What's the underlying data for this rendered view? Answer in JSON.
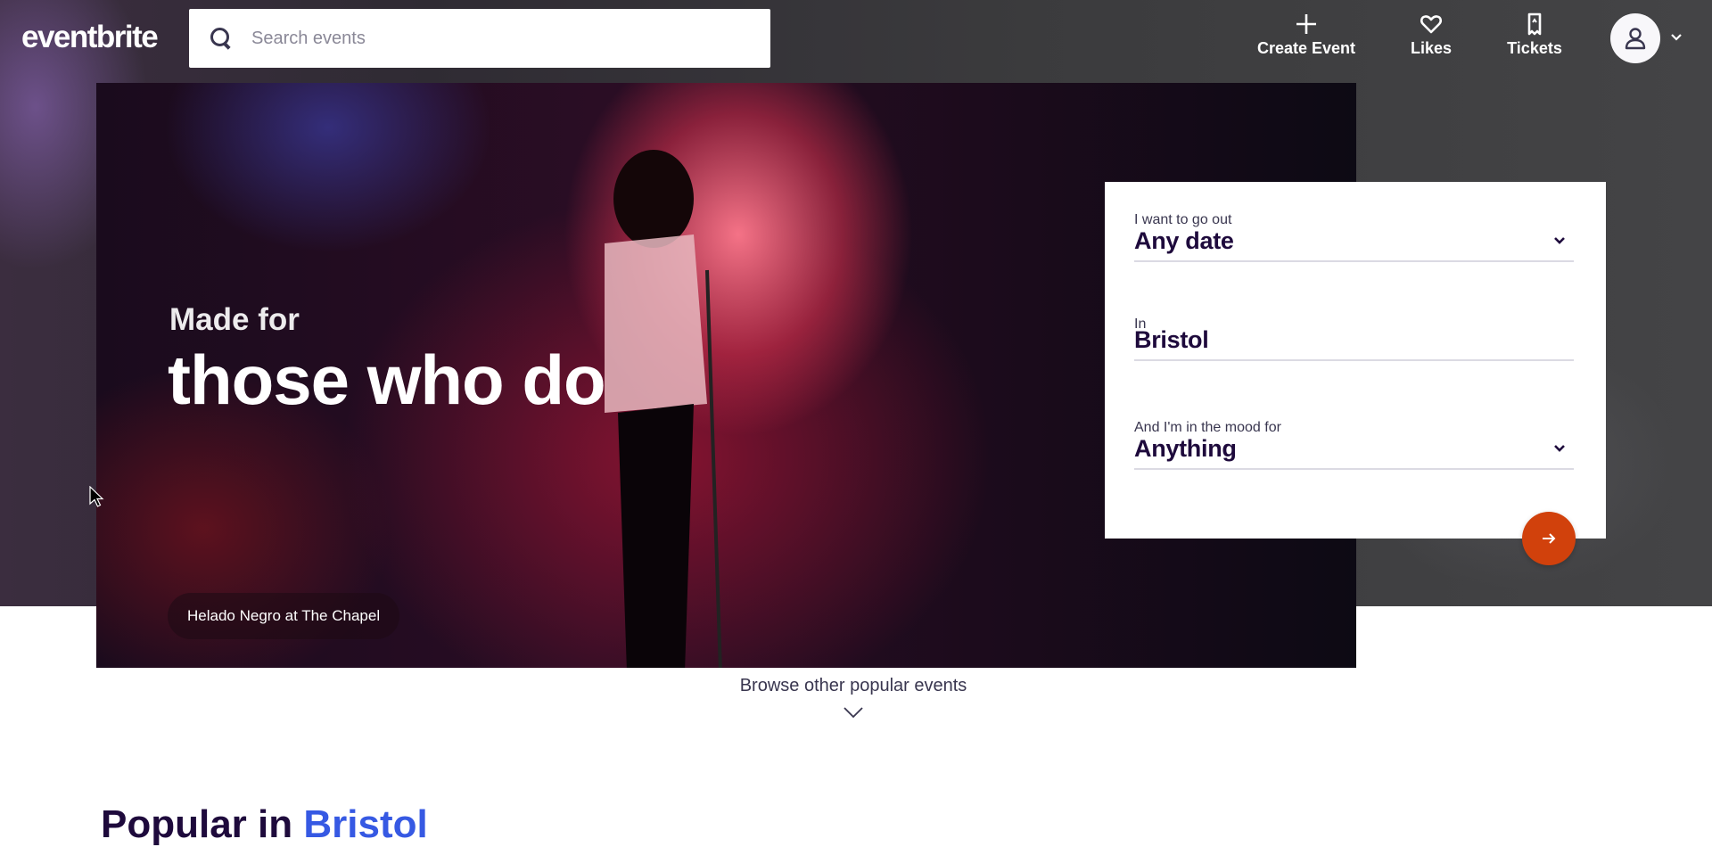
{
  "header": {
    "logo": "eventbrite",
    "search_placeholder": "Search events",
    "nav": {
      "create_event": "Create Event",
      "likes": "Likes",
      "tickets": "Tickets"
    }
  },
  "hero": {
    "subtitle": "Made for",
    "title": "those who do",
    "caption": "Helado Negro at The Chapel"
  },
  "search_card": {
    "date_label": "I want to go out",
    "date_value": "Any date",
    "location_label": "In",
    "location_value": "Bristol",
    "mood_label": "And I'm in the mood for",
    "mood_value": "Anything"
  },
  "browse": {
    "label": "Browse other popular events"
  },
  "popular": {
    "prefix": "Popular in",
    "city": "Bristol"
  },
  "colors": {
    "brand_orange": "#d1410c",
    "link_blue": "#3659e3",
    "text_dark": "#1e0a3c"
  },
  "icons": {
    "search": "search-icon",
    "create": "plus-icon",
    "likes": "heart-icon",
    "tickets": "ticket-icon",
    "avatar": "user-icon",
    "caret": "chevron-down-icon",
    "go": "arrow-right-icon"
  }
}
